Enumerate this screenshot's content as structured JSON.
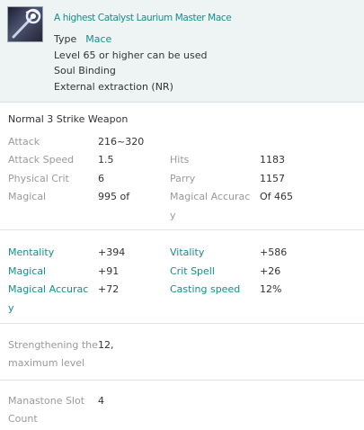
{
  "item": {
    "icon": "mace-icon",
    "title": "A highest Catalyst Laurium Master Mace",
    "type_label": "Type",
    "type_value": "Mace",
    "level_req": "Level 65 or higher can be used",
    "binding": "Soul Binding",
    "extraction": "External extraction (NR)"
  },
  "weapon_class": "Normal 3 Strike Weapon",
  "base_stats": {
    "attack_label": "Attack",
    "attack_value": "216~320",
    "hits_label": "Hits",
    "hits_value": "1183",
    "attack_speed_label": "Attack Speed",
    "attack_speed_value": "1.5",
    "parry_label": "Parry",
    "parry_value": "1157",
    "physical_crit_label": "Physical Crit",
    "physical_crit_value": "6",
    "magical_label": "Magical",
    "magical_value": "995 of",
    "magical_accuracy_label_1": "Magical Accurac",
    "magical_accuracy_label_2": "y",
    "magical_accuracy_value": "Of 465"
  },
  "bonus_stats": {
    "mentality_label": "Mentality",
    "mentality_value": "+394",
    "vitality_label": "Vitality",
    "vitality_value": "+586",
    "magical_label": "Magical",
    "magical_value": "+91",
    "crit_spell_label": "Crit Spell",
    "crit_spell_value": "+26",
    "magical_accuracy_label_1": "Magical Accurac",
    "magical_accuracy_label_2": "y",
    "magical_accuracy_value": "+72",
    "casting_speed_label": "Casting speed",
    "casting_speed_value": "12%"
  },
  "enchant": {
    "label_1": "Strengthening the",
    "label_2": "maximum level",
    "value": "12,"
  },
  "manastone": {
    "label_1": "Manastone Slot",
    "label_2": "Count",
    "value": "4"
  },
  "colors": {
    "accent": "#148f8a",
    "label_grey": "#9a9a9a",
    "text": "#333333",
    "header_bg": "#eef3f4"
  }
}
